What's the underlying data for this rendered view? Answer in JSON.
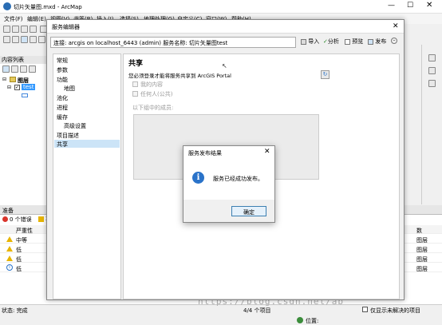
{
  "app": {
    "title": "切片矢量图.mxd - ArcMap",
    "menus": [
      "文件(F)",
      "编辑(E)",
      "视图(V)",
      "书签(B)",
      "插入(I)",
      "选择(S)",
      "地理处理(G)",
      "自定义(C)",
      "窗口(W)",
      "帮助(H)"
    ]
  },
  "toc": {
    "header": "内容列表",
    "layers_label": "图层",
    "layer_name": "test"
  },
  "prep": {
    "header": "准备",
    "error_count": "0 个错误",
    "warn_count": "3",
    "col_severity": "严重性",
    "col_type": "数",
    "rows": [
      {
        "severity": "中等",
        "type": "图层",
        "level": "warn"
      },
      {
        "severity": "低",
        "type": "图层",
        "level": "warn"
      },
      {
        "severity": "低",
        "type": "图层",
        "level": "warn"
      },
      {
        "severity": "低",
        "type": "图层",
        "level": "info"
      }
    ]
  },
  "status": {
    "left": "状态: 完成",
    "mid": "4/4 个项目",
    "right": "仅显示未解决的项目",
    "position": "位置:"
  },
  "svc": {
    "title": "服务编辑器",
    "connection": "连接: arcgis on localhost_6443 (admin)  服务名称: 切片矢量图test",
    "buttons": {
      "import": "导入",
      "analyze": "分析",
      "preview": "预览",
      "publish": "发布"
    },
    "nav": [
      "常规",
      "参数",
      "功能",
      "地图",
      "池化",
      "进程",
      "缓存",
      "高级设置",
      "项目描述",
      "共享"
    ],
    "share": {
      "heading": "共享",
      "note": "您必须登录才能将服务共享到 ArcGIS Portal",
      "my_content": "我的内容",
      "everyone": "任何人(公共)",
      "members": "以下组中的成员:"
    }
  },
  "result": {
    "title": "服务发布结果",
    "message": "服务已经成功发布。",
    "ok": "确定"
  },
  "watermark": "https://blog.csdn.net/ab"
}
